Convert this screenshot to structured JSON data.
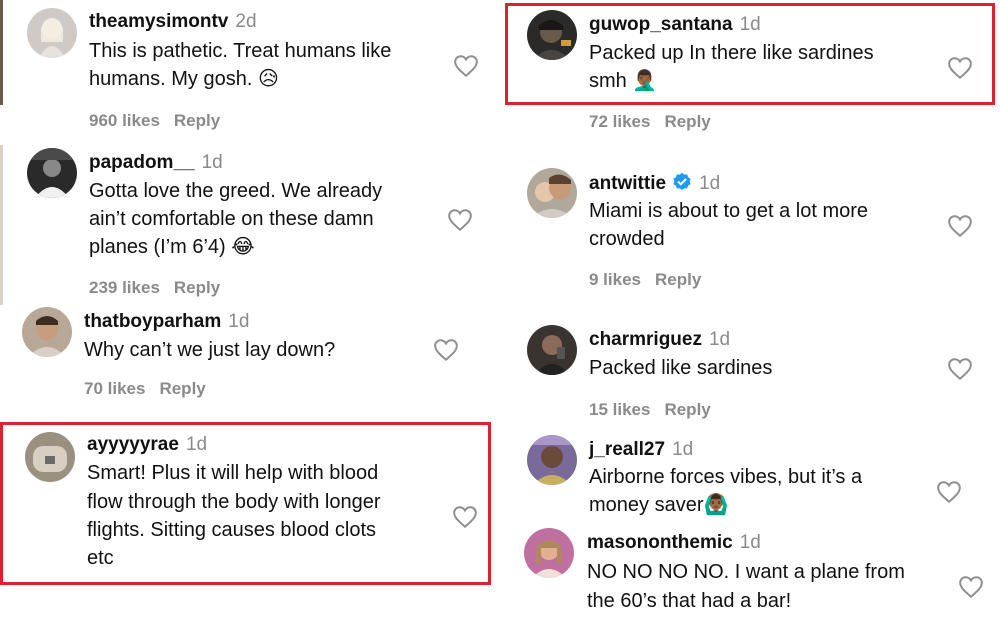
{
  "comments": [
    {
      "username": "theamysimontv",
      "time": "2d",
      "lines": [
        "This is pathetic. Treat humans like",
        "humans. My gosh. 😥"
      ],
      "likes": "960 likes",
      "reply": "Reply"
    },
    {
      "username": "papadom__",
      "time": "1d",
      "lines": [
        "Gotta love the greed. We already",
        "ain’t comfortable on these damn",
        "planes (I’m 6’4) 😂"
      ],
      "likes": "239 likes",
      "reply": "Reply"
    },
    {
      "username": "thatboyparham",
      "time": "1d",
      "lines": [
        "Why can’t we just lay down?"
      ],
      "likes": "70 likes",
      "reply": "Reply"
    },
    {
      "username": "ayyyyyrae",
      "time": "1d",
      "lines": [
        "Smart! Plus it will help with blood",
        "flow through the body with longer",
        "flights. Sitting causes blood clots",
        "etc"
      ],
      "likes": "",
      "reply": ""
    },
    {
      "username": "guwop_santana",
      "time": "1d",
      "lines": [
        "Packed up In there like sardines",
        "smh 🤦🏾‍♂️"
      ],
      "likes": "72 likes",
      "reply": "Reply"
    },
    {
      "username": "antwittie",
      "time": "1d",
      "lines": [
        "Miami is about to get a lot more",
        "crowded"
      ],
      "likes": "9 likes",
      "reply": "Reply"
    },
    {
      "username": "charmriguez",
      "time": "1d",
      "lines": [
        "Packed like sardines"
      ],
      "likes": "15 likes",
      "reply": "Reply"
    },
    {
      "username": "j_reall27",
      "time": "1d",
      "lines": [
        "Airborne forces vibes, but it’s a",
        "money saver🙆🏾‍♂️"
      ],
      "likes": "",
      "reply": ""
    },
    {
      "username": "masononthemic",
      "time": "1d",
      "lines": [
        "NO NO NO NO. I want a plane from",
        "the 60’s that had a bar!"
      ],
      "likes": "",
      "reply": ""
    }
  ],
  "icons": {
    "like": "heart-icon",
    "verified": "verified-badge-icon"
  },
  "colors": {
    "highlight": "#e0202a",
    "verified": "#1d9bf0",
    "muted": "#8a8a8a"
  }
}
